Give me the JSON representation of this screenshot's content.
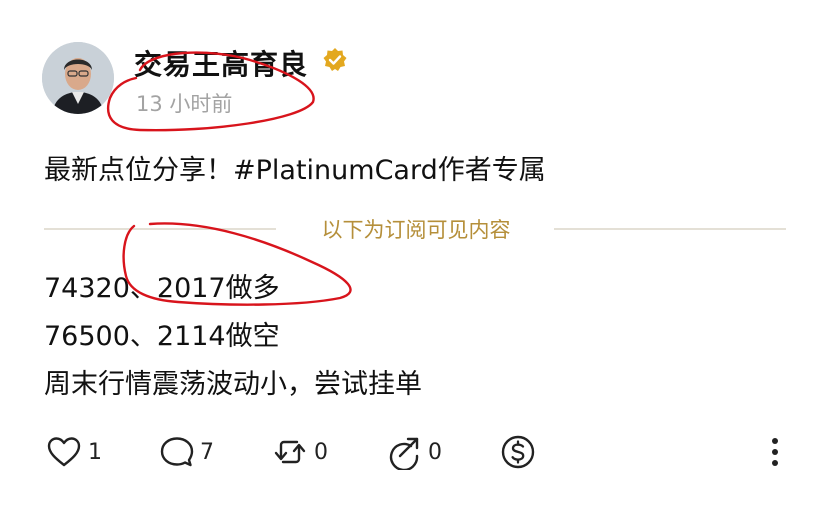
{
  "author": {
    "name": "交易王高育良",
    "timestamp": "13 小时前",
    "verified_color": "#e3a81f"
  },
  "post": {
    "text": "最新点位分享！#PlatinumCard作者专属",
    "subscriber_divider_label": "以下为订阅可见内容",
    "lines": [
      "74320、2017做多",
      "76500、2114做空",
      "周末行情震荡波动小，尝试挂单"
    ]
  },
  "actions": {
    "like_count": "1",
    "comment_count": "7",
    "repost_count": "0",
    "share_count": "0"
  },
  "icons": [
    "heart-icon",
    "comment-icon",
    "repost-icon",
    "share-icon",
    "tip-icon",
    "more-icon"
  ],
  "annotation_color": "#d8141c"
}
